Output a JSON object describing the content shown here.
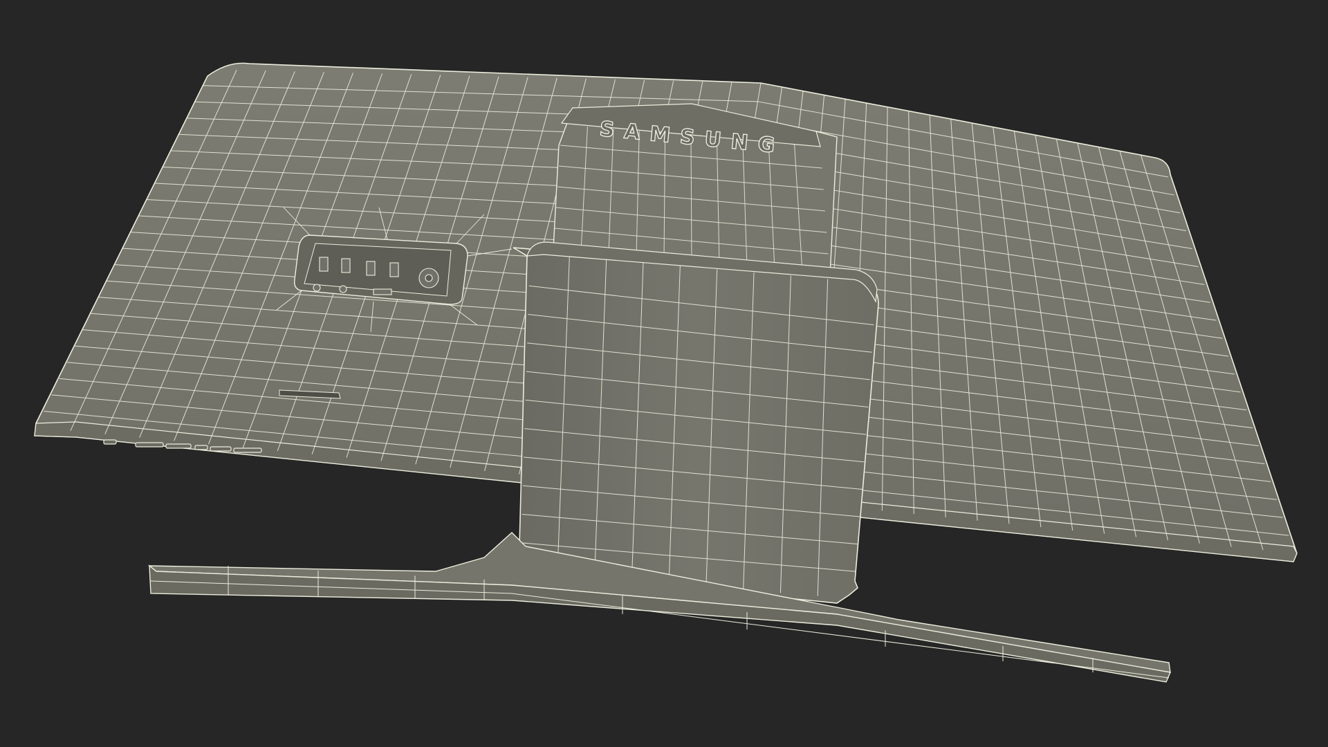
{
  "scene": {
    "background_color": "#262626",
    "surface_color": "#76766c",
    "wire_color": "#eceedd",
    "shade_color": "#55554c"
  },
  "model": {
    "brand_logo": "SAMSUNG"
  }
}
